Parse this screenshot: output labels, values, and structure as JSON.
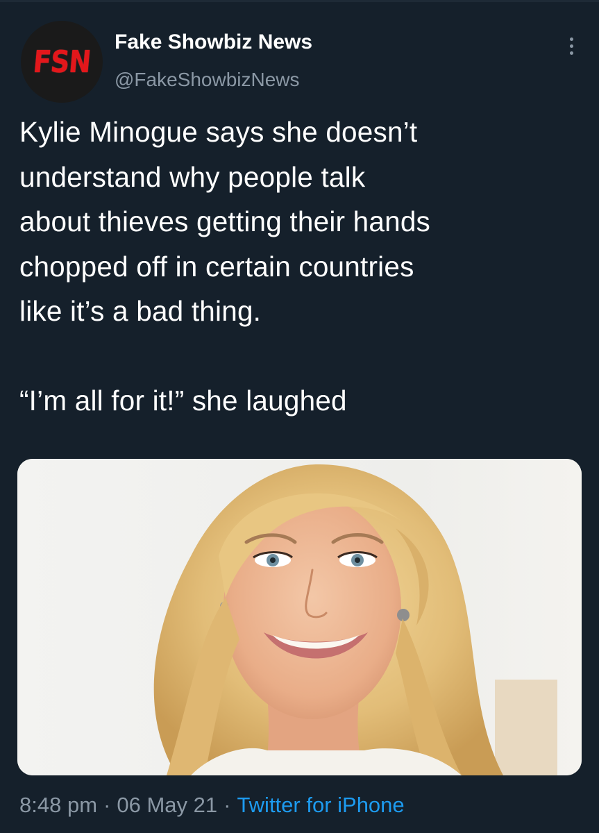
{
  "account": {
    "avatar_text": "FSN",
    "display_name": "Fake Showbiz News",
    "handle": "@FakeShowbizNews"
  },
  "tweet": {
    "text": "Kylie Minogue says she doesn’t\nunderstand why people talk\nabout thieves getting their hands\nchopped off in certain countries\nlike it’s a bad thing.\n\n“I’m all for it!” she laughed"
  },
  "meta": {
    "time": "8:48 pm",
    "separator": "·",
    "date": "06 May 21",
    "source": "Twitter for iPhone"
  },
  "icons": {
    "more": "more-vertical-icon"
  },
  "colors": {
    "background": "#15202b",
    "secondary_text": "#8b98a5",
    "link": "#1d9bf0",
    "avatar_brand": "#e3171b"
  }
}
